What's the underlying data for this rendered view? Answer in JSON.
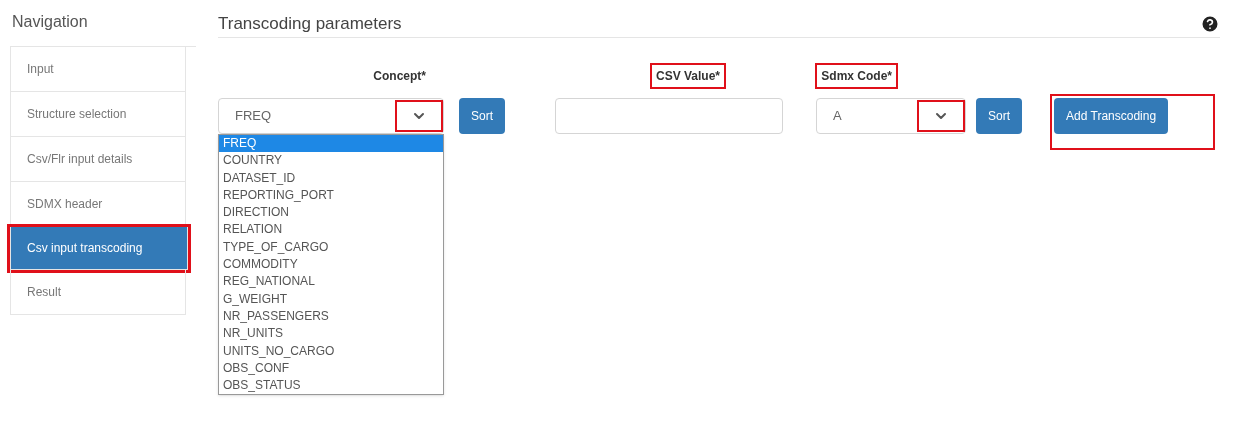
{
  "sidebar": {
    "title": "Navigation",
    "items": [
      {
        "label": "Input",
        "selected": false,
        "highlighted": false
      },
      {
        "label": "Structure selection",
        "selected": false,
        "highlighted": false
      },
      {
        "label": "Csv/Flr input details",
        "selected": false,
        "highlighted": false
      },
      {
        "label": "SDMX header",
        "selected": false,
        "highlighted": false
      },
      {
        "label": "Csv input transcoding",
        "selected": true,
        "highlighted": true
      },
      {
        "label": "Result",
        "selected": false,
        "highlighted": false
      }
    ]
  },
  "main": {
    "title": "Transcoding parameters",
    "concept": {
      "label": "Concept*",
      "label_highlighted": false,
      "value": "FREQ",
      "caret_highlighted": true,
      "sort": "Sort",
      "expanded": true,
      "options": [
        {
          "label": "FREQ",
          "selected": true
        },
        {
          "label": "COUNTRY",
          "selected": false
        },
        {
          "label": "DATASET_ID",
          "selected": false
        },
        {
          "label": "REPORTING_PORT",
          "selected": false
        },
        {
          "label": "DIRECTION",
          "selected": false
        },
        {
          "label": "RELATION",
          "selected": false
        },
        {
          "label": "TYPE_OF_CARGO",
          "selected": false
        },
        {
          "label": "COMMODITY",
          "selected": false
        },
        {
          "label": "REG_NATIONAL",
          "selected": false
        },
        {
          "label": "G_WEIGHT",
          "selected": false
        },
        {
          "label": "NR_PASSENGERS",
          "selected": false
        },
        {
          "label": "NR_UNITS",
          "selected": false
        },
        {
          "label": "UNITS_NO_CARGO",
          "selected": false
        },
        {
          "label": "OBS_CONF",
          "selected": false
        },
        {
          "label": "OBS_STATUS",
          "selected": false
        }
      ]
    },
    "csv_value": {
      "label": "CSV Value*",
      "label_highlighted": true
    },
    "sdmx_code": {
      "label": "Sdmx Code*",
      "label_highlighted": true,
      "value": "A",
      "caret_highlighted": true,
      "sort": "Sort"
    },
    "add_button": {
      "label": "Add Transcoding",
      "highlighted": true
    }
  }
}
